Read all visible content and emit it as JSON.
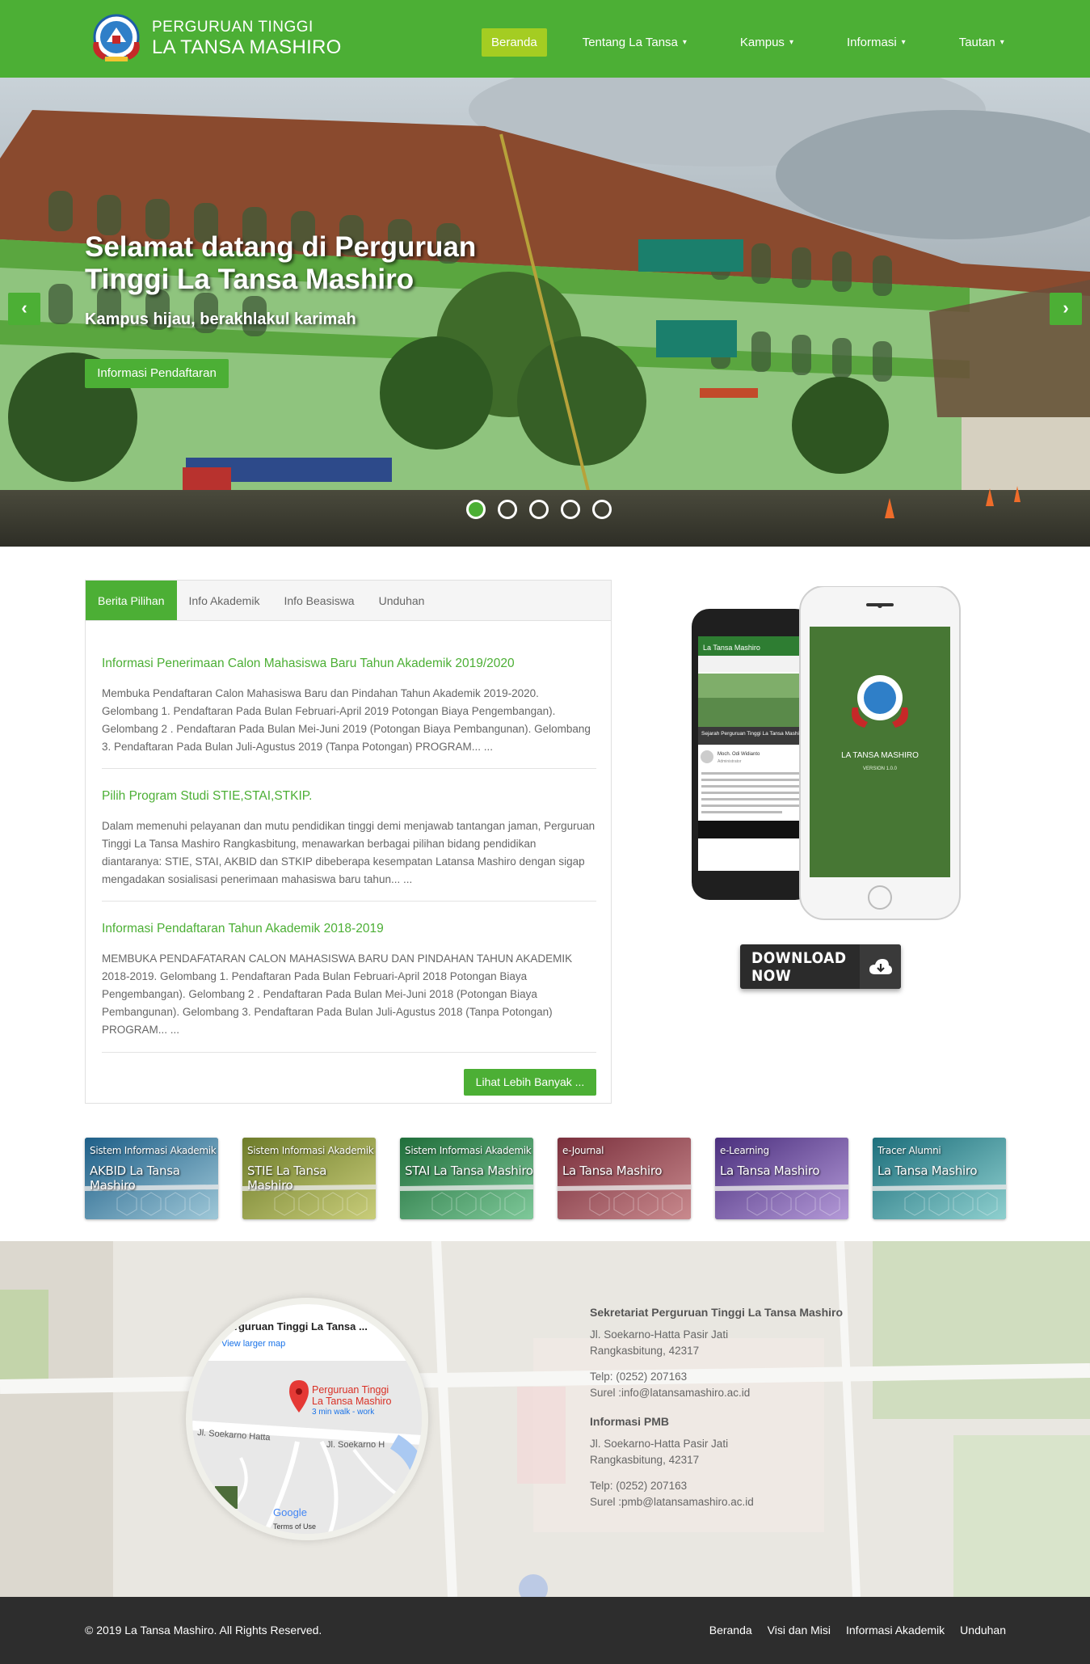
{
  "colors": {
    "brand_green": "#4caf35",
    "active_nav": "#a4cd22",
    "footer_bg": "#2d2d2d"
  },
  "brand": {
    "line1": "PERGURUAN TINGGI",
    "line2": "LA TANSA MASHIRO",
    "logo_icon": "crest-logo"
  },
  "nav": {
    "items": [
      {
        "label": "Beranda",
        "active": true,
        "dropdown": false
      },
      {
        "label": "Tentang La Tansa",
        "active": false,
        "dropdown": true
      },
      {
        "label": "Kampus",
        "active": false,
        "dropdown": true
      },
      {
        "label": "Informasi",
        "active": false,
        "dropdown": true
      },
      {
        "label": "Tautan",
        "active": false,
        "dropdown": true
      }
    ],
    "caret": "▾"
  },
  "hero": {
    "title": "Selamat datang di Perguruan Tinggi La Tansa Mashiro",
    "subtitle": "Kampus hijau, berakhlakul karimah",
    "button": "Informasi Pendaftaran",
    "prev_icon": "‹",
    "next_icon": "›",
    "slide_count": 5,
    "active_slide": 1
  },
  "news": {
    "tabs": [
      "Berita Pilihan",
      "Info Akademik",
      "Info Beasiswa",
      "Unduhan"
    ],
    "active_tab": 0,
    "articles": [
      {
        "title": "Informasi Penerimaan Calon Mahasiswa Baru Tahun Akademik 2019/2020",
        "body": "Membuka Pendaftaran Calon Mahasiswa Baru dan Pindahan Tahun Akademik 2019-2020. Gelombang 1. Pendaftaran Pada Bulan Februari-April 2019  Potongan Biaya Pengembangan). Gelombang 2 . Pendaftaran Pada Bulan Mei-Juni 2019 (Potongan Biaya Pembangunan). Gelombang 3. Pendaftaran Pada Bulan Juli-Agustus 2019 (Tanpa Potongan) PROGRAM... ..."
      },
      {
        "title": "Pilih Program Studi STIE,STAI,STKIP.",
        "body": "Dalam memenuhi pelayanan dan mutu pendidikan tinggi demi menjawab tantangan jaman, Perguruan Tinggi La Tansa Mashiro Rangkasbitung, menawarkan berbagai pilihan bidang pendidikan diantaranya: STIE, STAI, AKBID dan STKIP dibeberapa kesempatan Latansa Mashiro dengan sigap mengadakan sosialisasi penerimaan mahasiswa baru tahun... ..."
      },
      {
        "title": "Informasi Pendaftaran Tahun Akademik 2018-2019",
        "body": " MEMBUKA PENDAFATARAN CALON MAHASISWA BARU DAN PINDAHAN TAHUN AKADEMIK 2018-2019. Gelombang 1. Pendaftaran Pada Bulan Februari-April 2018  Potongan Biaya Pengembangan). Gelombang 2 . Pendaftaran Pada Bulan Mei-Juni 2018 (Potongan Biaya Pembangunan). Gelombang 3. Pendaftaran Pada Bulan Juli-Agustus 2018 (Tanpa Potongan) PROGRAM... ..."
      }
    ],
    "more_button": "Lihat Lebih Banyak ..."
  },
  "app": {
    "app_title": "La Tansa Mashiro",
    "splash_title": "LA TANSA MASHIRO",
    "splash_version": "VERSION 1.0.0",
    "article_caption": "Sejarah Perguruan Tinggi La Tansa Mashiro",
    "author": "Moch. Odi Widianto",
    "role": "Administrator",
    "download_label": "DOWNLOAD NOW",
    "download_icon": "cloud-download-icon"
  },
  "systems": [
    {
      "small": "Sistem Informasi Akademik",
      "big": "AKBID La Tansa Mashiro",
      "color1": "#1e5f88",
      "color2": "#9fc8d8"
    },
    {
      "small": "Sistem Informasi Akademik",
      "big": "STIE La Tansa Mashiro",
      "color1": "#6e7c2a",
      "color2": "#c9cd7a"
    },
    {
      "small": "Sistem Informasi Akademik",
      "big": "STAI La Tansa Mashiro",
      "color1": "#1f6e3a",
      "color2": "#7fc99a"
    },
    {
      "small": "e-Journal",
      "big": "La Tansa Mashiro",
      "color1": "#7a2f3c",
      "color2": "#c98a8e"
    },
    {
      "small": "e-Learning",
      "big": "La Tansa Mashiro",
      "color1": "#4b2f7e",
      "color2": "#b49ad8"
    },
    {
      "small": "Tracer Alumni",
      "big": "La Tansa Mashiro",
      "color1": "#1d6f7c",
      "color2": "#8fd0cf"
    }
  ],
  "map": {
    "place_name": "Perguruan Tinggi La Tansa ...",
    "larger_map": "View larger map",
    "pin_label_1": "Perguruan Tinggi",
    "pin_label_2": "La Tansa Mashiro",
    "walk": "3 min walk - work",
    "road_1": "Jl. Soekarno Hatta",
    "road_2": "Jl. Soekarno H",
    "google": "Google",
    "terms": "Terms of Use"
  },
  "contact": {
    "secretariat": {
      "heading": "Sekretariat Perguruan Tinggi La Tansa Mashiro",
      "address1": "Jl. Soekarno-Hatta Pasir Jati",
      "address2": "Rangkasbitung, 42317",
      "phone": "Telp: (0252) 207163",
      "email": "Surel :info@latansamashiro.ac.id"
    },
    "pmb": {
      "heading": "Informasi PMB",
      "address1": "Jl. Soekarno-Hatta Pasir Jati",
      "address2": "Rangkasbitung, 42317",
      "phone": "Telp: (0252) 207163",
      "email": "Surel :pmb@latansamashiro.ac.id"
    }
  },
  "footer": {
    "copyright": "© 2019 La Tansa Mashiro. All Rights Reserved.",
    "links": [
      "Beranda",
      "Visi dan Misi",
      "Informasi Akademik",
      "Unduhan"
    ]
  }
}
